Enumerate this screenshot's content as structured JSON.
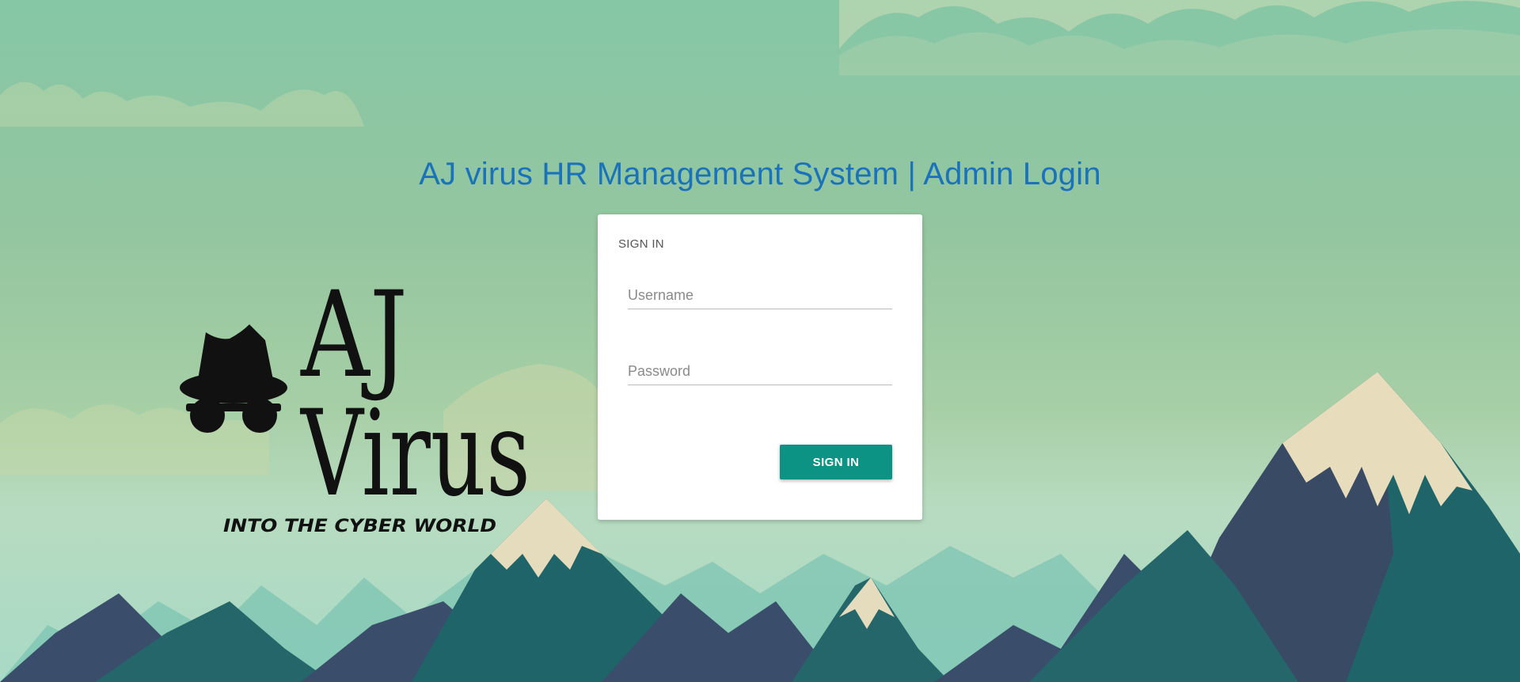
{
  "page": {
    "title": "AJ virus HR Management System | Admin Login"
  },
  "brand": {
    "line1": "AJ",
    "line2": "Virus",
    "tagline": "INTO THE CYBER WORLD",
    "icon": "spy-hat-glasses-icon"
  },
  "login": {
    "header": "SIGN IN",
    "username": {
      "placeholder": "Username",
      "value": ""
    },
    "password": {
      "placeholder": "Password",
      "value": ""
    },
    "submit_label": "SIGN IN"
  },
  "colors": {
    "title": "#1a72bb",
    "button": "#0d9384",
    "sky_top": "#86c7a6",
    "mountain_dark": "#384a64",
    "mountain_teal": "#1f6468"
  }
}
